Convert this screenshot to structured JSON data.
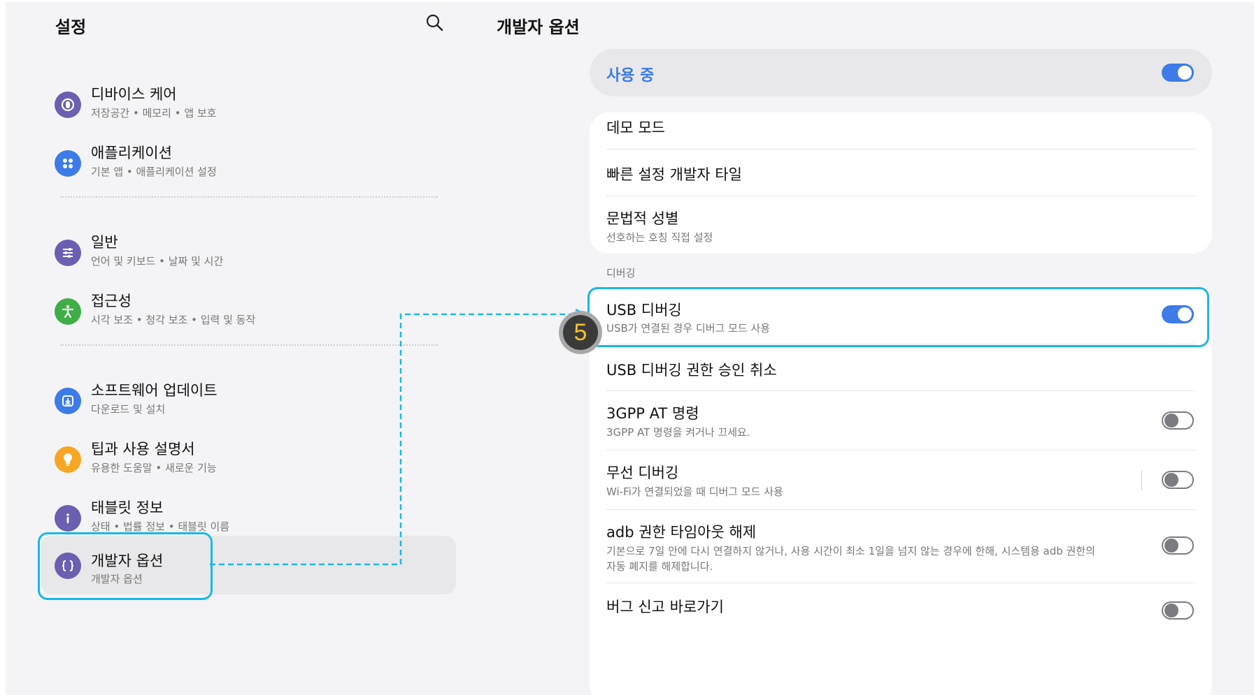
{
  "left_panel": {
    "title": "설정",
    "search_icon": "search-icon",
    "items": [
      {
        "title": "디바이스 케어",
        "subtitle": "저장공간 • 메모리 • 앱 보호",
        "icon": "device-care-icon",
        "color": "#6a5fb0"
      },
      {
        "title": "애플리케이션",
        "subtitle": "기본 앱 • 애플리케이션 설정",
        "icon": "apps-icon",
        "color": "#3c7be8"
      },
      {
        "title": "일반",
        "subtitle": "언어 및 키보드 • 날짜 및 시간",
        "icon": "general-icon",
        "color": "#6a5fb0"
      },
      {
        "title": "접근성",
        "subtitle": "시각 보조 • 청각 보조 • 입력 및 동작",
        "icon": "accessibility-icon",
        "color": "#3fae49"
      },
      {
        "title": "소프트웨어 업데이트",
        "subtitle": "다운로드 및 설치",
        "icon": "software-update-icon",
        "color": "#3c7be8"
      },
      {
        "title": "팁과 사용 설명서",
        "subtitle": "유용한 도움말 • 새로운 기능",
        "icon": "tips-icon",
        "color": "#f5a623"
      },
      {
        "title": "태블릿 정보",
        "subtitle": "상태 • 법률 정보 • 태블릿 이름",
        "icon": "info-icon",
        "color": "#6a5fb0"
      },
      {
        "title": "개발자 옵션",
        "subtitle": "개발자 옵션",
        "icon": "developer-options-icon",
        "color": "#6a5fb0",
        "selected": true
      }
    ]
  },
  "right_panel": {
    "title": "개발자 옵션",
    "master": {
      "label": "사용 중",
      "toggle": "on",
      "label_color": "#3c7be8"
    },
    "group1": {
      "items": [
        {
          "title": "데모 모드"
        },
        {
          "title": "빠른 설정 개발자 타일"
        },
        {
          "title": "문법적 성별",
          "subtitle": "선호하는 호칭 직접 설정"
        }
      ]
    },
    "section_header": "디버깅",
    "group2": {
      "items": [
        {
          "title": "USB 디버깅",
          "subtitle": "USB가 연결된 경우 디버그 모드 사용",
          "toggle": "on"
        },
        {
          "title": "USB 디버깅 권한 승인 취소"
        },
        {
          "title": "3GPP AT 명령",
          "subtitle": "3GPP AT 명령을 켜거나 끄세요.",
          "toggle": "off"
        },
        {
          "title": "무선 디버깅",
          "subtitle": "Wi-Fi가 연결되었을 때 디버그 모드 사용",
          "toggle": "off"
        },
        {
          "title": "adb 권한 타임아웃 해제",
          "subtitle_line1": "기본으로 7일 안에 다시 연결하지 않거나, 사용 시간이 최소 1일을 넘지 않는 경우에 한해, 시스템용 adb 권한의",
          "subtitle_line2": "자동 폐지를 해제합니다.",
          "toggle": "off"
        },
        {
          "title": "버그 신고 바로가기"
        }
      ]
    }
  },
  "annotation": {
    "step_number": "5",
    "highlight_color": "#19b8e6",
    "badge_number_color": "#f2c230"
  }
}
